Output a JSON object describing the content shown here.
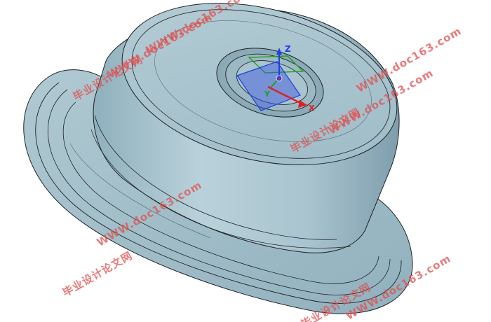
{
  "colors": {
    "background": "#ffffff",
    "model_light": "#b8ced6",
    "model_mid": "#a3bfca",
    "model_dark": "#7a98a5",
    "edge": "#1c2226",
    "axis_x": "#e02020",
    "axis_y": "#20a020",
    "axis_z": "#2040e0",
    "watermark": "#e05050"
  },
  "triad": {
    "x_label": "X",
    "y_label": "Y",
    "z_label": "Z"
  },
  "watermark": {
    "line_cn": "毕业设计论文网",
    "line_url": "WWW.doc163.com"
  },
  "viewport": {
    "icons": [
      "coordinate-triad-icon",
      "datum-plane-icon"
    ]
  }
}
